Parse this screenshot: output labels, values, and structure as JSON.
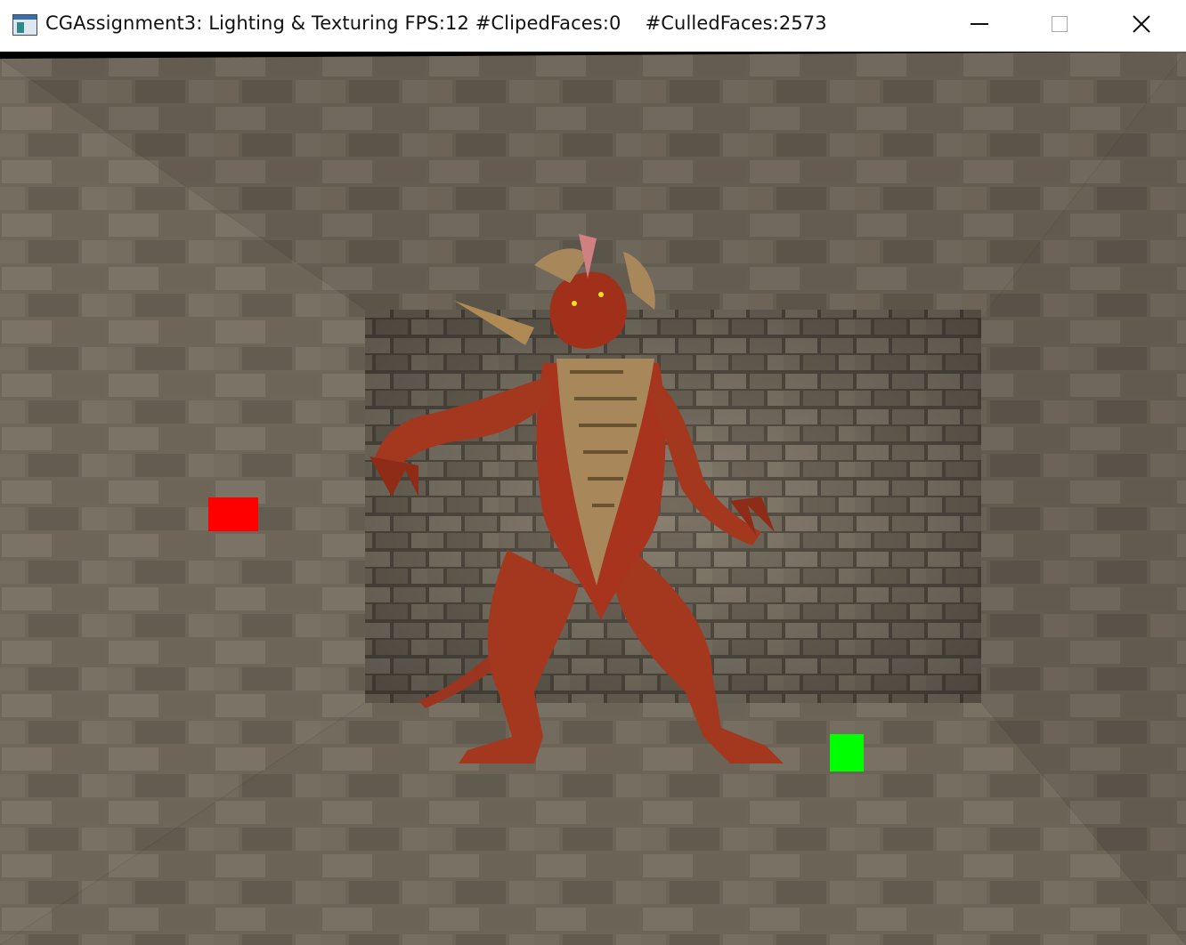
{
  "window": {
    "title": "CGAssignment3: Lighting & Texturing FPS:12 #ClipedFaces:0    #CulledFaces:2573",
    "icon": "app-window-icon",
    "controls": {
      "minimize_icon": "minimize-icon",
      "maximize_icon": "maximize-icon",
      "close_icon": "close-icon"
    }
  },
  "scene": {
    "wall_color": "#6e6658",
    "brick_color": "#8a8172",
    "mortar_color": "#4a443a",
    "creature_color": "#a8341e",
    "chest_color": "#a8875a",
    "red_light_color": "#ff0000",
    "green_light_color": "#00ff00"
  }
}
